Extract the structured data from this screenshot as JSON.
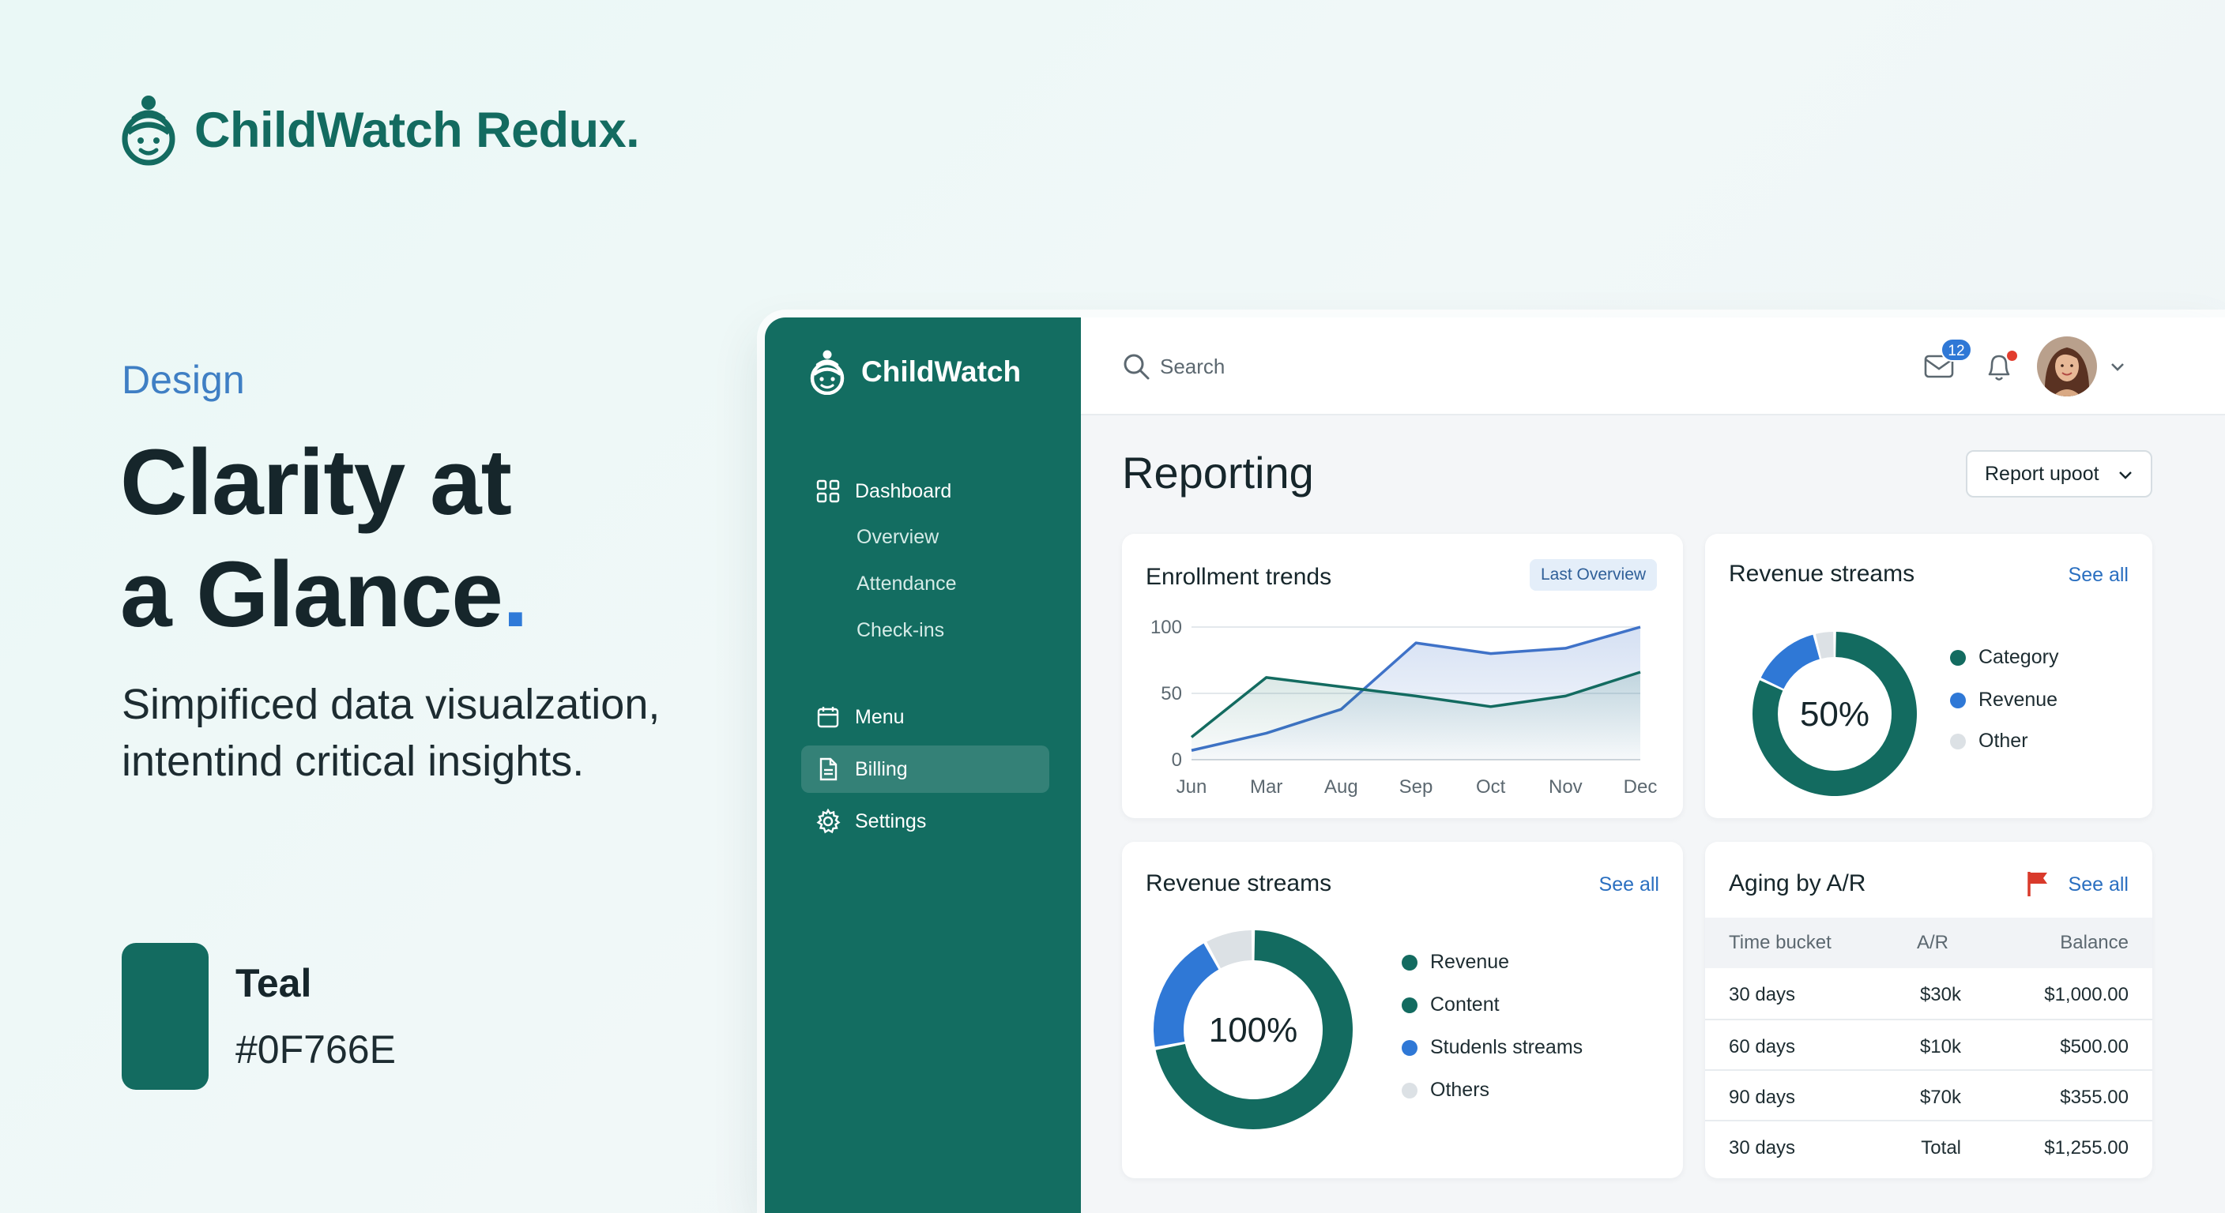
{
  "brand": {
    "name": "ChildWatch Redux."
  },
  "hero": {
    "eyebrow": "Design",
    "headline_line1": "Clarity at",
    "headline_line2": "a Glance",
    "headline_dot": ".",
    "subline_line1": "Simpificed data visualzation,",
    "subline_line2": "intentind critical insights."
  },
  "swatch": {
    "name": "Teal",
    "hex": "#0F766E",
    "color": "#136B60"
  },
  "app": {
    "sidebar": {
      "brand": "ChildWatch",
      "items": [
        {
          "label": "Dashboard",
          "icon": "grid-icon"
        },
        {
          "label": "Menu",
          "icon": "calendar-icon"
        },
        {
          "label": "Billing",
          "icon": "document-icon",
          "active": true
        },
        {
          "label": "Settings",
          "icon": "gear-icon"
        }
      ],
      "subitems": [
        "Overview",
        "Attendance",
        "Check-ins"
      ]
    },
    "topbar": {
      "search_placeholder": "Search",
      "mail_badge": "12"
    },
    "page_title": "Reporting",
    "report_button": "Report upoot",
    "enrollment": {
      "title": "Enrollment trends",
      "chip": "Last Overview"
    },
    "revenue_top": {
      "title": "Revenue streams",
      "see_all": "See all",
      "center": "50%",
      "legend": [
        {
          "label": "Category",
          "color": "#136B60"
        },
        {
          "label": "Revenue",
          "color": "#2F78D6"
        },
        {
          "label": "Other",
          "color": "#DCE1E5"
        }
      ]
    },
    "revenue_bottom": {
      "title": "Revenue streams",
      "see_all": "See all",
      "center": "100%",
      "legend": [
        {
          "label": "Revenue",
          "color": "#136B60"
        },
        {
          "label": "Content",
          "color": "#136B60"
        },
        {
          "label": "Studenls streams",
          "color": "#2F78D6"
        },
        {
          "label": "Others",
          "color": "#DCE1E5"
        }
      ]
    },
    "aging": {
      "title": "Aging by A/R",
      "see_all": "See all",
      "headers": [
        "Time bucket",
        "A/R",
        "Balance"
      ],
      "rows": [
        [
          "30 days",
          "$30k",
          "$1,000.00"
        ],
        [
          "60 days",
          "$10k",
          "$500.00"
        ],
        [
          "90 days",
          "$70k",
          "$355.00"
        ],
        [
          "30 days",
          "Total",
          "$1,255.00"
        ]
      ]
    }
  },
  "chart_data": [
    {
      "type": "line",
      "title": "Enrollment trends",
      "categories": [
        "Jun",
        "Mar",
        "Aug",
        "Sep",
        "Oct",
        "Nov",
        "Dec"
      ],
      "ylim": [
        0,
        100
      ],
      "yticks": [
        0,
        50,
        100
      ],
      "grid": true,
      "series": [
        {
          "values": [
            7,
            20,
            38,
            88,
            80,
            84,
            100
          ],
          "color": "#3F72C8",
          "fill": true
        },
        {
          "values": [
            17,
            62,
            55,
            48,
            40,
            48,
            66
          ],
          "color": "#136B60",
          "fill": true
        }
      ]
    },
    {
      "type": "pie",
      "title": "Revenue streams",
      "center_label": "50%",
      "slices": [
        {
          "label": "Category",
          "value": 82,
          "color": "#136B60"
        },
        {
          "label": "Revenue",
          "value": 14,
          "color": "#2F78D6"
        },
        {
          "label": "Other",
          "value": 4,
          "color": "#DCE1E5"
        }
      ]
    },
    {
      "type": "pie",
      "title": "Revenue streams",
      "center_label": "100%",
      "slices": [
        {
          "label": "Revenue",
          "value": 72,
          "color": "#136B60"
        },
        {
          "label": "Studenls streams",
          "value": 20,
          "color": "#2F78D6"
        },
        {
          "label": "Others",
          "value": 8,
          "color": "#DCE1E5"
        }
      ]
    }
  ]
}
